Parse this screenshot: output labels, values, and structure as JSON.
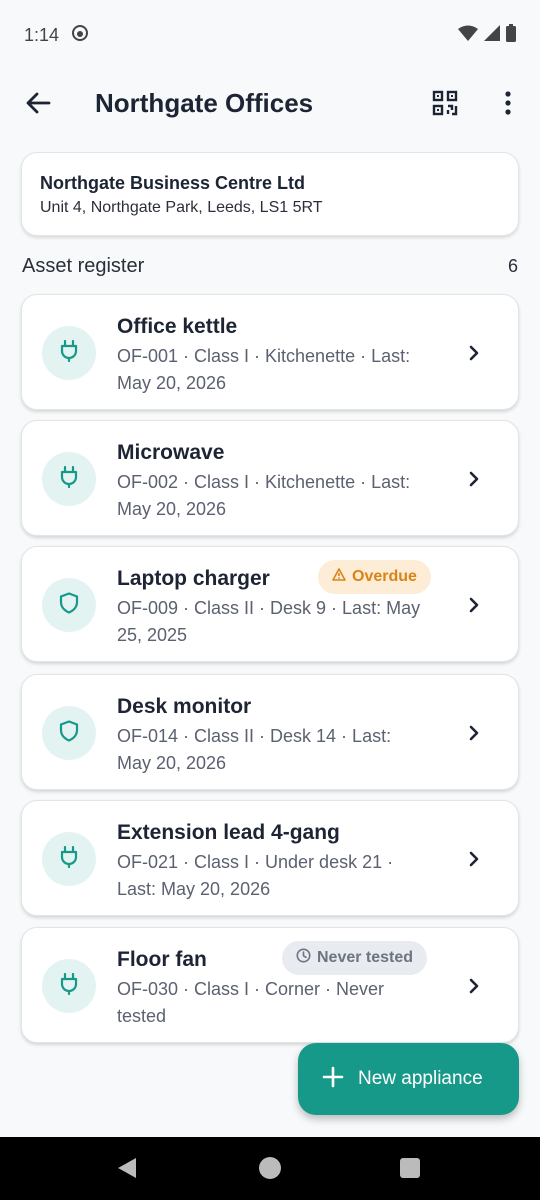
{
  "status": {
    "time": "1:14"
  },
  "appbar": {
    "title": "Northgate Offices"
  },
  "client": {
    "name": "Northgate Business Centre Ltd",
    "address": "Unit 4, Northgate Park, Leeds, LS1 5RT"
  },
  "register": {
    "title": "Asset register",
    "count": "6"
  },
  "assets": [
    {
      "name": "Office kettle",
      "icon": "plug-icon",
      "detail": "OF-001 · Class I · Kitchenette · Last: May 20, 2026",
      "badge": ""
    },
    {
      "name": "Microwave",
      "icon": "plug-icon",
      "detail": "OF-002 · Class I · Kitchenette · Last: May 20, 2026",
      "badge": ""
    },
    {
      "name": "Laptop charger",
      "icon": "shield-icon",
      "detail": "OF-009 · Class II · Desk 9 · Last: May 25, 2025",
      "badge": "Overdue"
    },
    {
      "name": "Desk monitor",
      "icon": "shield-icon",
      "detail": "OF-014 · Class II · Desk 14 · Last: May 20, 2026",
      "badge": ""
    },
    {
      "name": "Extension lead 4-gang",
      "icon": "plug-icon",
      "detail": "OF-021 · Class I · Under desk 21 · Last: May 20, 2026",
      "badge": ""
    },
    {
      "name": "Floor fan",
      "icon": "plug-icon",
      "detail": "OF-030 · Class I · Corner · Never tested",
      "badge": "Never tested"
    }
  ],
  "fab": {
    "label": "New appliance"
  },
  "colors": {
    "accent": "#17998a",
    "overdue": "#d98414",
    "never": "#6d7482"
  }
}
